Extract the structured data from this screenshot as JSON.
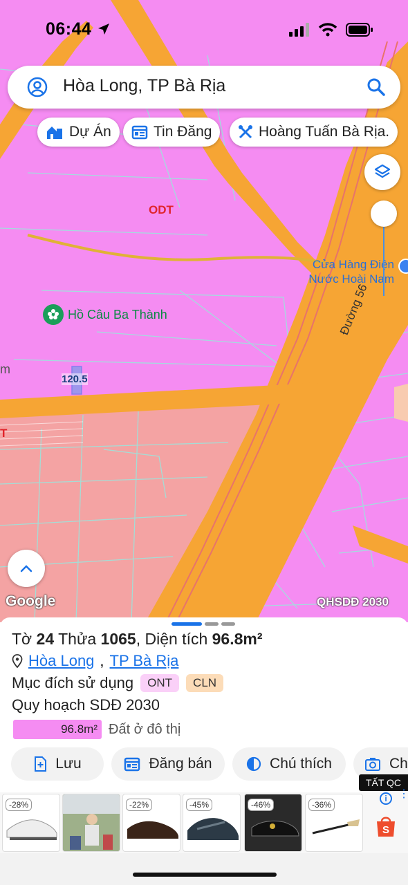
{
  "status_bar": {
    "time": "06:44"
  },
  "search": {
    "value": "Hòa Long, TP Bà Rịa"
  },
  "chips": [
    {
      "label": "Dự Án",
      "icon": "building-icon"
    },
    {
      "label": "Tin Đăng",
      "icon": "listing-icon"
    },
    {
      "label": "Hoàng Tuấn Bà Rịa.",
      "icon": "tools-icon"
    }
  ],
  "map": {
    "zone_label_odt": "ODT",
    "zone_label_t": "T",
    "poi_store": "Cửa Hàng Điện\nNước Hoài Nam",
    "poi_fishing": "Hồ Câu Ba Thành",
    "road_label": "Đường 56",
    "parcel_label": "120.5",
    "edge_label_m": "m",
    "google_logo": "Google",
    "plan_label": "QHSDĐ 2030"
  },
  "parcel": {
    "to_label": "Tờ",
    "to_number": "24",
    "thua_label": "Thửa",
    "thua_number": "1065",
    "area_label": "Diện tích",
    "area_value": "96.8m²",
    "ward": "Hòa Long",
    "city": "TP Bà Rịa",
    "purpose_label": "Mục đích sử dụng",
    "purpose_tags": [
      "ONT",
      "CLN"
    ],
    "plan_title": "Quy hoạch SDĐ 2030",
    "plan_area": "96.8m²",
    "plan_desc": "Đất ở đô thị"
  },
  "actions": [
    {
      "label": "Lưu",
      "icon": "save-icon"
    },
    {
      "label": "Đăng bán",
      "icon": "post-icon"
    },
    {
      "label": "Chú thích",
      "icon": "legend-icon"
    },
    {
      "label": "Ch",
      "icon": "camera-icon"
    }
  ],
  "ad_badge": "TẤT QC",
  "ads": [
    {
      "discount": "-28%",
      "item": "sneaker"
    },
    {
      "discount": "",
      "item": "photo"
    },
    {
      "discount": "-22%",
      "item": "leather-shoe"
    },
    {
      "discount": "-45%",
      "item": "sandal"
    },
    {
      "discount": "-46%",
      "item": "loafer"
    },
    {
      "discount": "-36%",
      "item": "shoehorn"
    }
  ],
  "colors": {
    "odt_zone": "#f58cf2",
    "road": "#f6a534",
    "ont_zone": "#f4a3a3",
    "link": "#1a73e8"
  }
}
